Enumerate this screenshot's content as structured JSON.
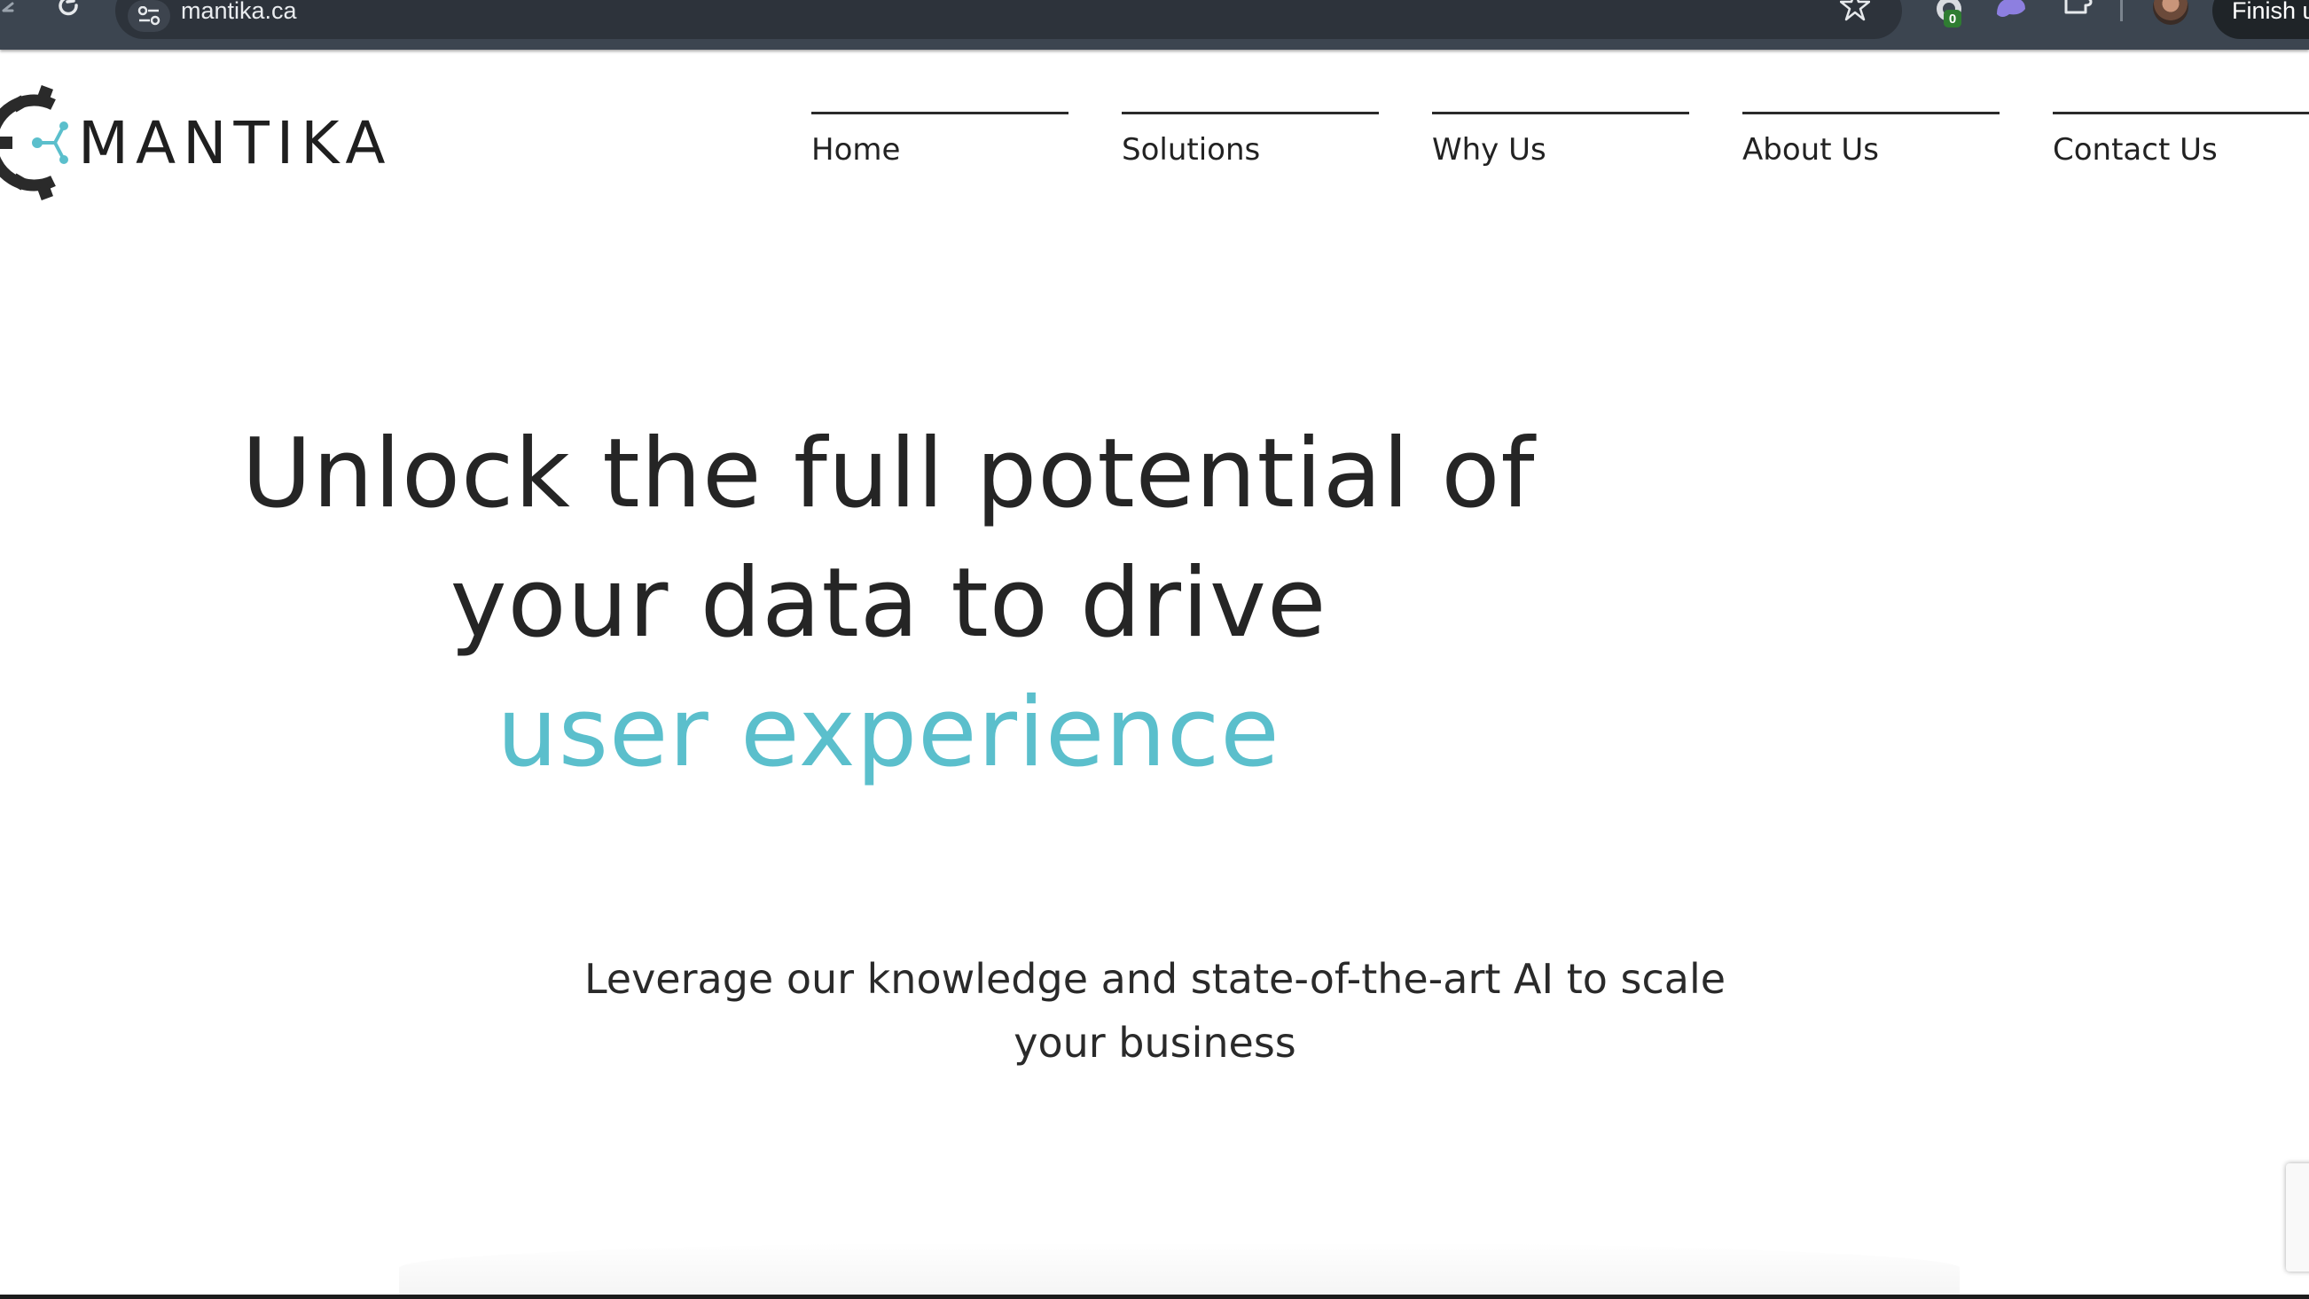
{
  "browser": {
    "url": "mantika.ca",
    "extension_badge": "0",
    "finish_button_label": "Finish u",
    "icons": [
      "back-arrow-icon",
      "reload-icon",
      "site-settings-icon",
      "bookmark-star-icon",
      "extension-icon",
      "ai-extension-icon",
      "extensions-puzzle-icon",
      "profile-avatar"
    ]
  },
  "site": {
    "logo_text": "MANTIKA",
    "brand_color": "#5bbfcc",
    "nav": [
      {
        "label": "Home"
      },
      {
        "label": "Solutions"
      },
      {
        "label": "Why Us"
      },
      {
        "label": "About Us"
      },
      {
        "label": "Contact Us"
      }
    ]
  },
  "hero": {
    "line1": "Unlock the full potential of",
    "line2": "your data to drive",
    "line3": "user experience",
    "subtitle": "Leverage our knowledge and state-of-the-art AI to scale your business"
  }
}
